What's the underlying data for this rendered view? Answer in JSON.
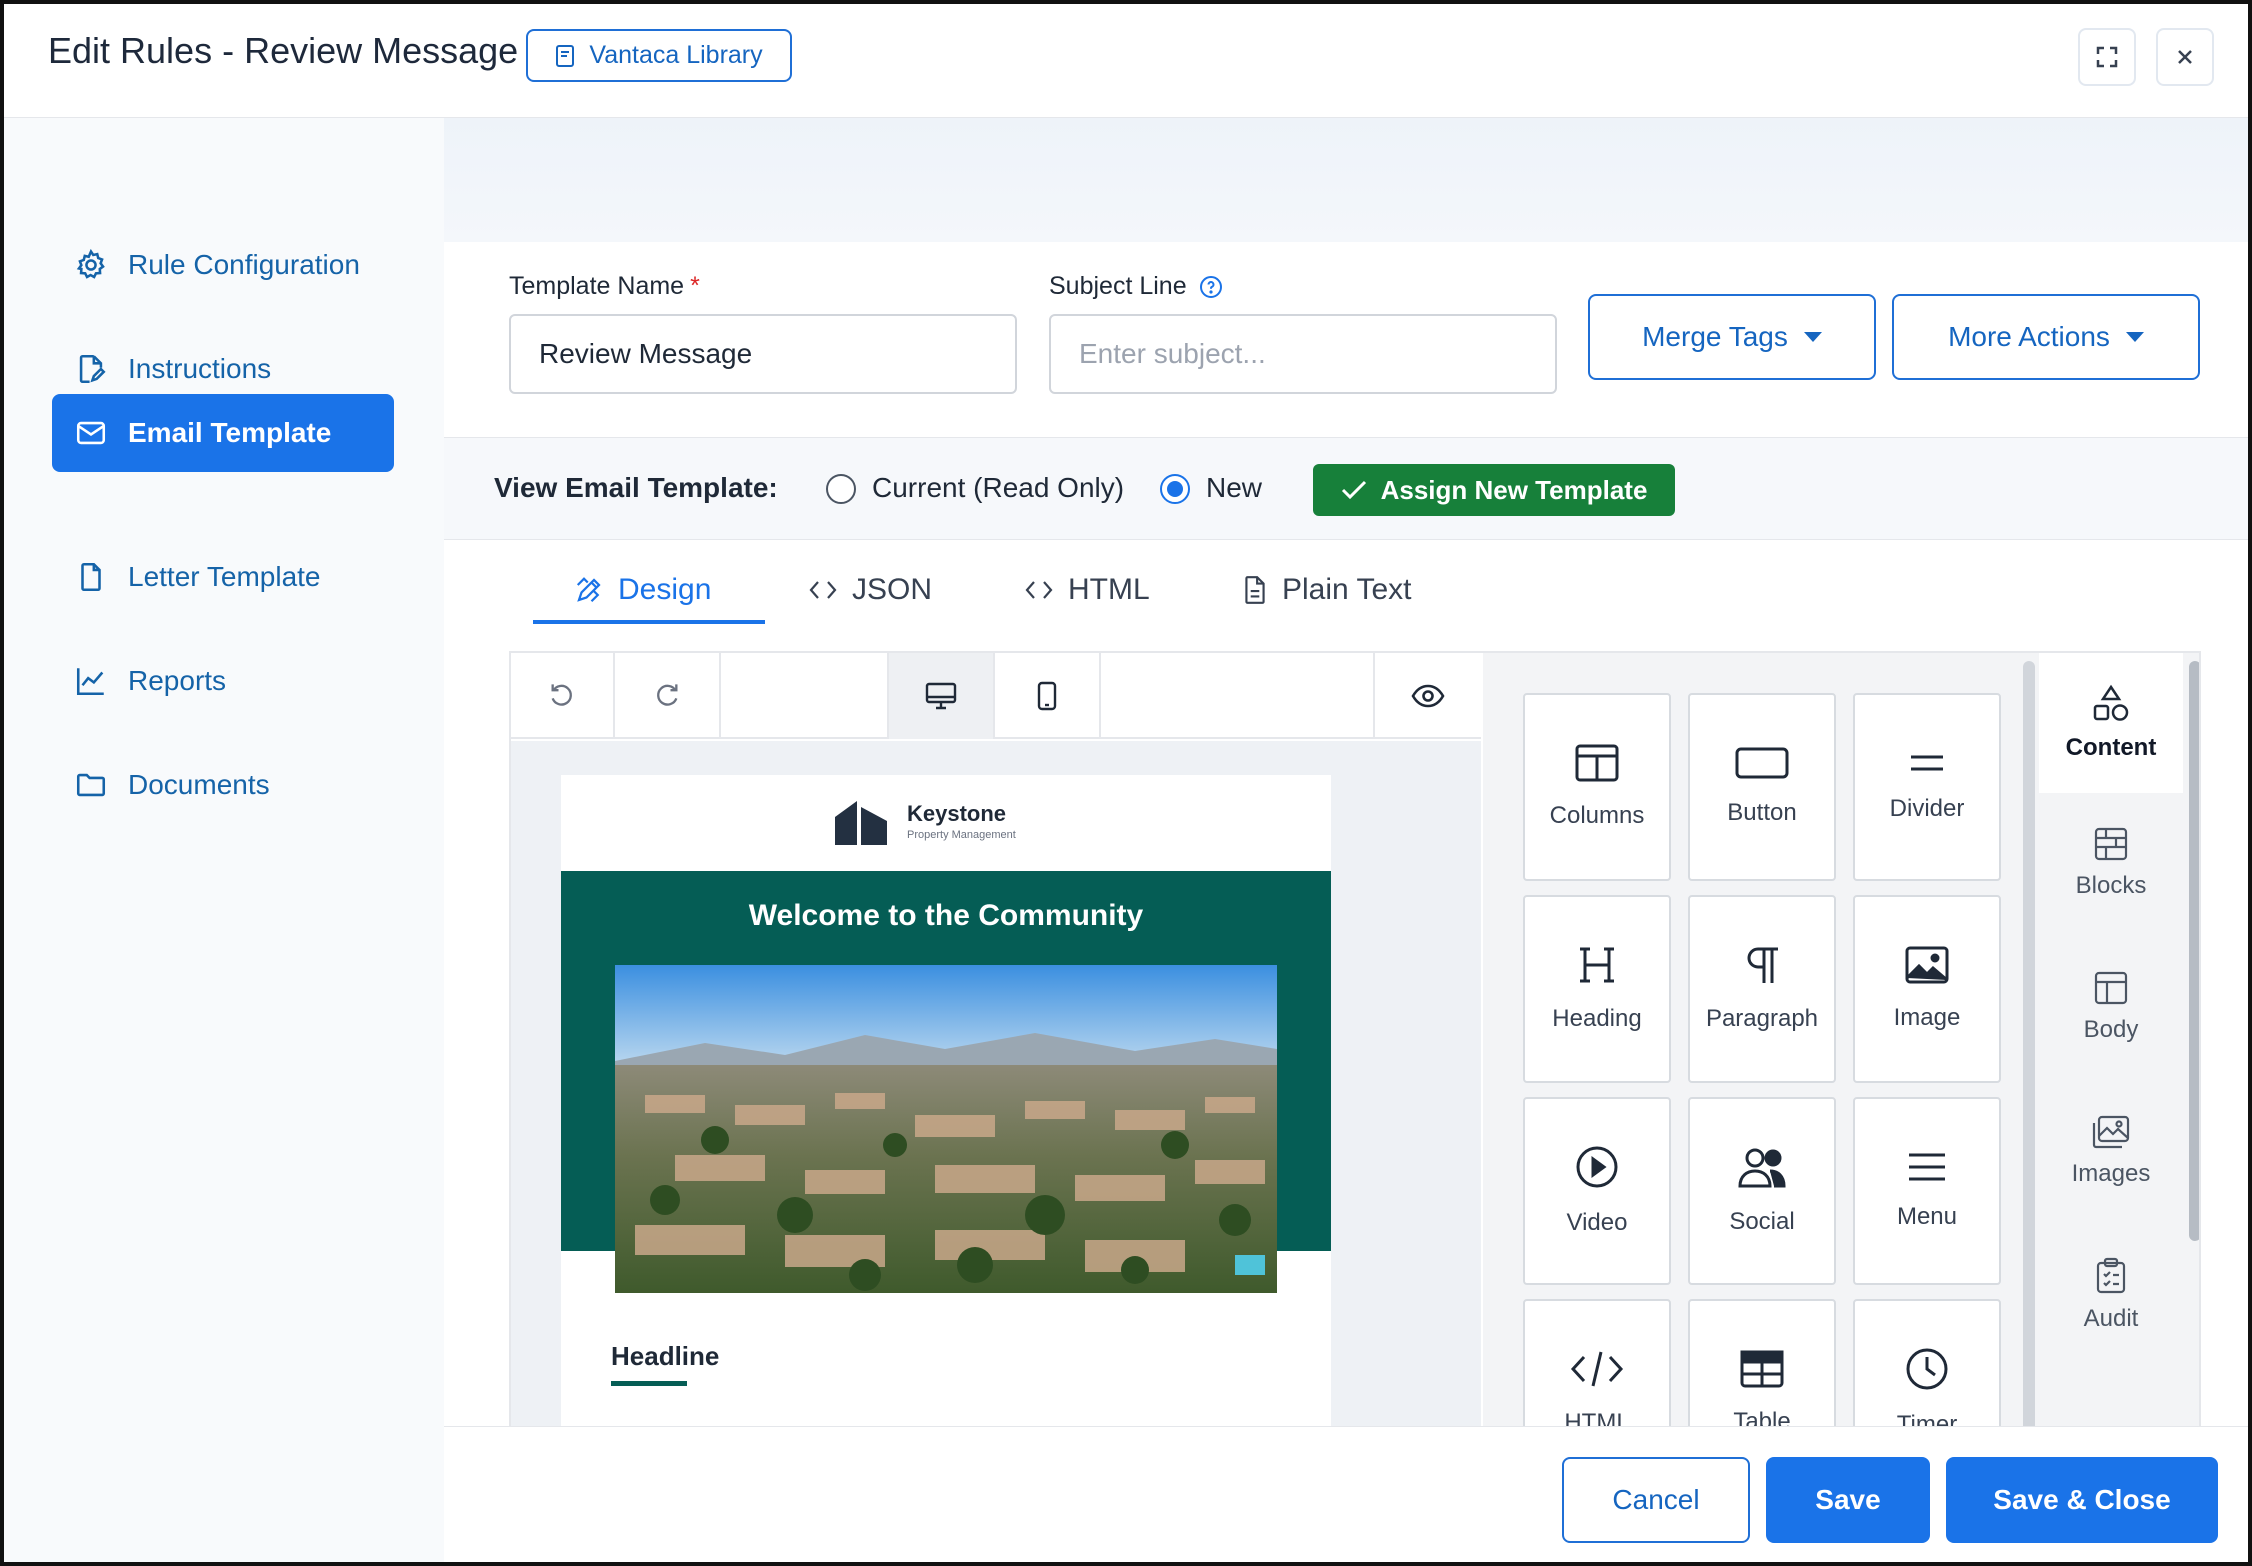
{
  "header": {
    "title": "Edit Rules - Review Message",
    "library_label": "Vantaca Library"
  },
  "sidebar": {
    "items": [
      {
        "label": "Rule Configuration",
        "icon": "gear-icon"
      },
      {
        "label": "Instructions",
        "icon": "edit-document-icon"
      },
      {
        "label": "Email Template",
        "icon": "envelope-icon",
        "active": true
      },
      {
        "label": "Letter Template",
        "icon": "document-icon"
      },
      {
        "label": "Reports",
        "icon": "chart-line-icon"
      },
      {
        "label": "Documents",
        "icon": "folder-icon"
      }
    ]
  },
  "form": {
    "template_name_label": "Template Name",
    "required_mark": "*",
    "template_name_value": "Review Message",
    "subject_label": "Subject Line",
    "subject_placeholder": "Enter subject...",
    "merge_tags_label": "Merge Tags",
    "more_actions_label": "More Actions"
  },
  "view": {
    "label": "View Email Template:",
    "option_current": "Current (Read Only)",
    "option_new": "New",
    "selected": "New",
    "assign_label": "Assign New Template"
  },
  "tabs": [
    {
      "label": "Design",
      "active": true
    },
    {
      "label": "JSON"
    },
    {
      "label": "HTML"
    },
    {
      "label": "Plain Text"
    }
  ],
  "email_preview": {
    "logo_name": "Keystone",
    "logo_sub": "Property Management",
    "hero_title": "Welcome to the Community",
    "headline": "Headline"
  },
  "content_tiles": [
    {
      "label": "Columns",
      "icon": "columns-icon"
    },
    {
      "label": "Button",
      "icon": "button-icon"
    },
    {
      "label": "Divider",
      "icon": "divider-icon"
    },
    {
      "label": "Heading",
      "icon": "heading-icon"
    },
    {
      "label": "Paragraph",
      "icon": "paragraph-icon"
    },
    {
      "label": "Image",
      "icon": "image-icon"
    },
    {
      "label": "Video",
      "icon": "video-icon"
    },
    {
      "label": "Social",
      "icon": "social-icon"
    },
    {
      "label": "Menu",
      "icon": "menu-icon"
    },
    {
      "label": "HTML",
      "icon": "code-icon"
    },
    {
      "label": "Table",
      "icon": "table-icon"
    },
    {
      "label": "Timer",
      "icon": "clock-icon"
    }
  ],
  "side_tabs": [
    {
      "label": "Content",
      "icon": "shapes-icon",
      "active": true
    },
    {
      "label": "Blocks",
      "icon": "blocks-icon"
    },
    {
      "label": "Body",
      "icon": "layout-icon"
    },
    {
      "label": "Images",
      "icon": "images-icon"
    },
    {
      "label": "Audit",
      "icon": "clipboard-icon"
    }
  ],
  "footer": {
    "cancel_label": "Cancel",
    "save_label": "Save",
    "save_close_label": "Save & Close"
  },
  "colors": {
    "primary": "#1a73e8",
    "assign_green": "#17803a",
    "hero_teal": "#055d55"
  }
}
